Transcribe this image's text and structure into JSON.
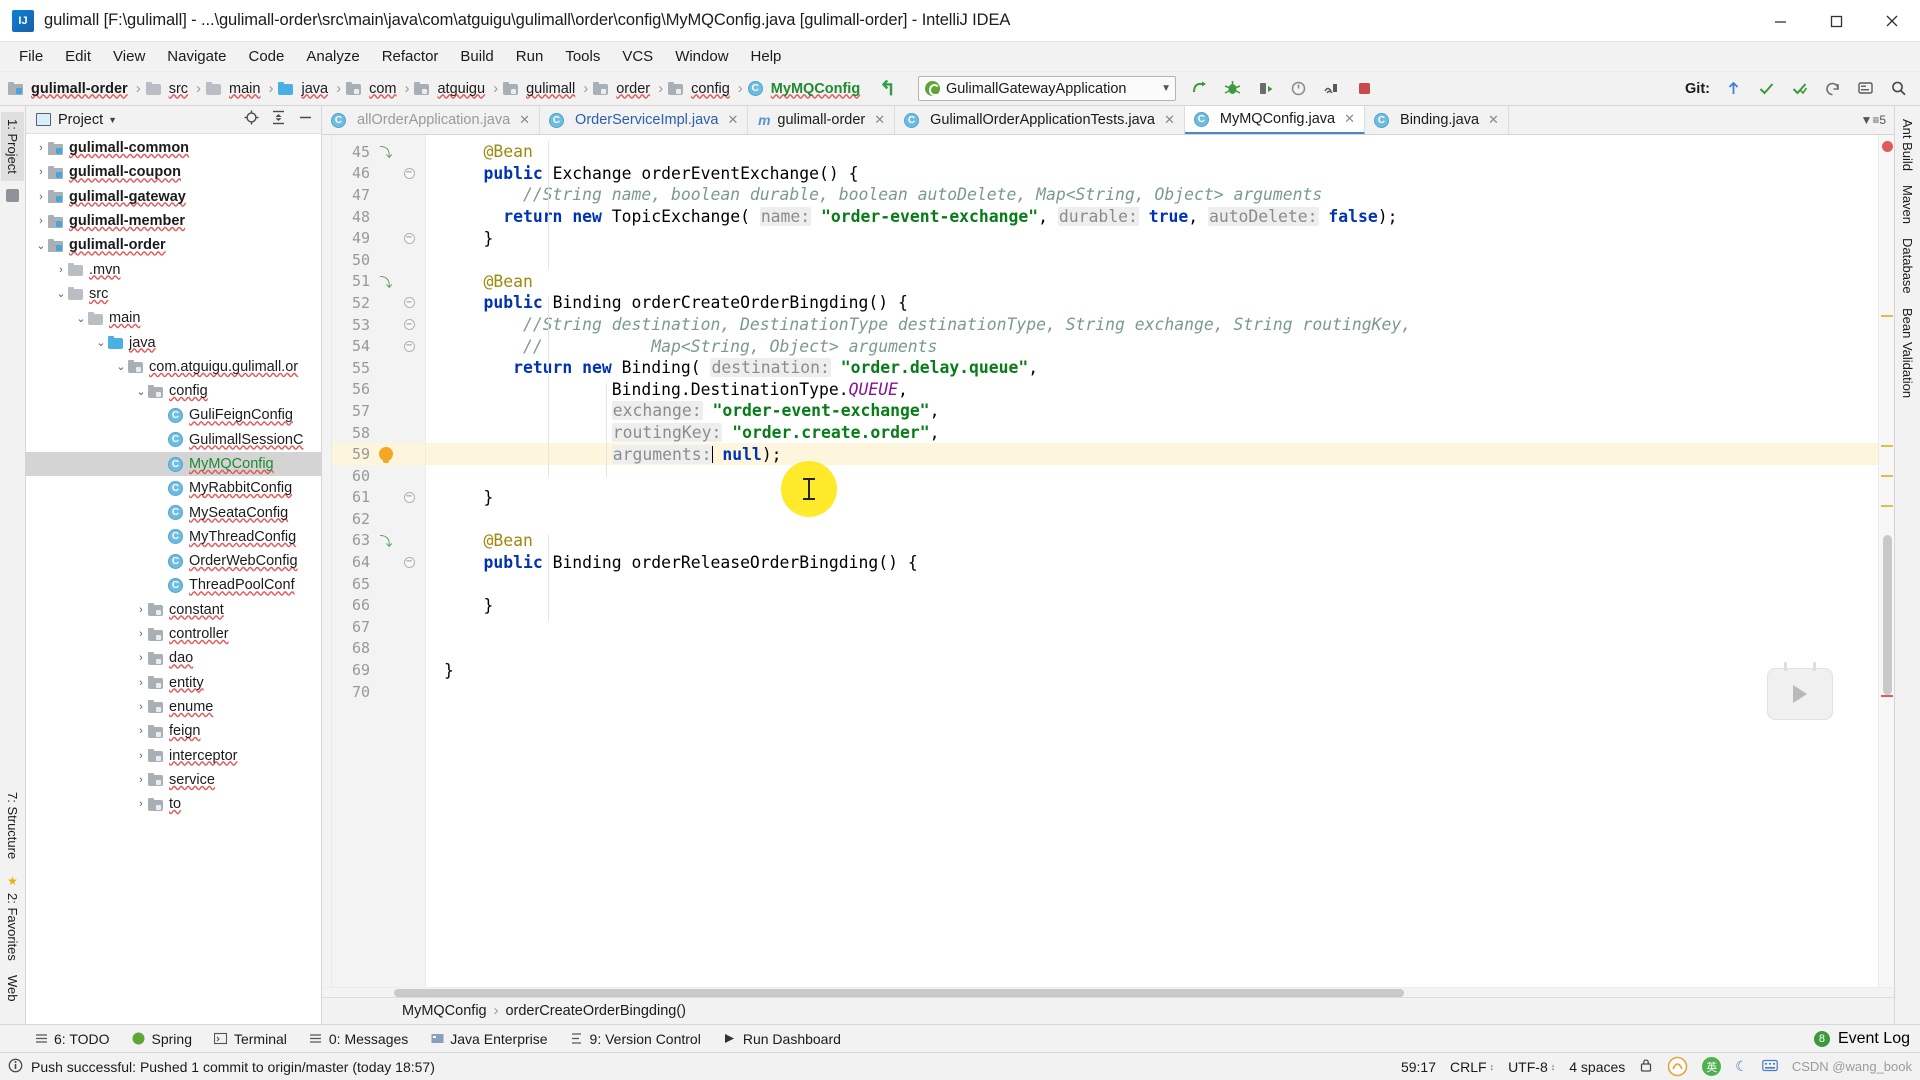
{
  "window": {
    "title": "gulimall [F:\\gulimall] - ...\\gulimall-order\\src\\main\\java\\com\\atguigu\\gulimall\\order\\config\\MyMQConfig.java [gulimall-order] - IntelliJ IDEA",
    "minimize_label": "—",
    "maximize_label": "□",
    "close_label": "✕"
  },
  "menubar": {
    "items": [
      "File",
      "Edit",
      "View",
      "Navigate",
      "Code",
      "Analyze",
      "Refactor",
      "Build",
      "Run",
      "Tools",
      "VCS",
      "Window",
      "Help"
    ]
  },
  "navbar": {
    "breadcrumbs": [
      {
        "label": "gulimall-order",
        "icon": "module-icon",
        "bold": true
      },
      {
        "label": "src",
        "icon": "folder-icon"
      },
      {
        "label": "main",
        "icon": "folder-icon"
      },
      {
        "label": "java",
        "icon": "source-folder-icon"
      },
      {
        "label": "com",
        "icon": "package-icon"
      },
      {
        "label": "atguigu",
        "icon": "package-icon"
      },
      {
        "label": "gulimall",
        "icon": "package-icon"
      },
      {
        "label": "order",
        "icon": "package-icon"
      },
      {
        "label": "config",
        "icon": "package-icon"
      },
      {
        "label": "MyMQConfig",
        "icon": "class-icon",
        "green": true
      }
    ],
    "run_config": "GulimallGatewayApplication",
    "git_label": "Git:",
    "toolbar_icons": [
      "run-icon",
      "debug-icon",
      "run-with-coverage-icon",
      "profiler-icon",
      "services-icon",
      "stop-icon"
    ],
    "git_icons": [
      "update-project-icon",
      "commit-icon",
      "push-icon",
      "rollback-icon",
      "ide-settings-icon",
      "search-everywhere-icon"
    ]
  },
  "project_panel": {
    "title": "Project",
    "tree": [
      {
        "label": "gulimall-common",
        "indent": 0,
        "arrow": "›",
        "icon": "module-icon",
        "bold": true
      },
      {
        "label": "gulimall-coupon",
        "indent": 0,
        "arrow": "›",
        "icon": "module-icon",
        "bold": true
      },
      {
        "label": "gulimall-gateway",
        "indent": 0,
        "arrow": "›",
        "icon": "module-icon",
        "bold": true
      },
      {
        "label": "gulimall-member",
        "indent": 0,
        "arrow": "›",
        "icon": "module-icon",
        "bold": true
      },
      {
        "label": "gulimall-order",
        "indent": 0,
        "arrow": "⌄",
        "icon": "module-icon",
        "bold": true
      },
      {
        "label": ".mvn",
        "indent": 1,
        "arrow": "›",
        "icon": "folder-icon"
      },
      {
        "label": "src",
        "indent": 1,
        "arrow": "⌄",
        "icon": "folder-icon"
      },
      {
        "label": "main",
        "indent": 2,
        "arrow": "⌄",
        "icon": "folder-icon"
      },
      {
        "label": "java",
        "indent": 3,
        "arrow": "⌄",
        "icon": "source-folder-icon"
      },
      {
        "label": "com.atguigu.gulimall.or",
        "indent": 4,
        "arrow": "⌄",
        "icon": "package-icon"
      },
      {
        "label": "config",
        "indent": 5,
        "arrow": "⌄",
        "icon": "package-icon"
      },
      {
        "label": "GuliFeignConfig",
        "indent": 6,
        "arrow": "",
        "icon": "class-icon"
      },
      {
        "label": "GulimallSessionC",
        "indent": 6,
        "arrow": "",
        "icon": "class-icon"
      },
      {
        "label": "MyMQConfig",
        "indent": 6,
        "arrow": "",
        "icon": "class-icon",
        "selected": true,
        "green": true
      },
      {
        "label": "MyRabbitConfig",
        "indent": 6,
        "arrow": "",
        "icon": "class-icon"
      },
      {
        "label": "MySeataConfig",
        "indent": 6,
        "arrow": "",
        "icon": "class-icon"
      },
      {
        "label": "MyThreadConfig",
        "indent": 6,
        "arrow": "",
        "icon": "class-icon"
      },
      {
        "label": "OrderWebConfig",
        "indent": 6,
        "arrow": "",
        "icon": "class-icon"
      },
      {
        "label": "ThreadPoolConf",
        "indent": 6,
        "arrow": "",
        "icon": "class-icon"
      },
      {
        "label": "constant",
        "indent": 5,
        "arrow": "›",
        "icon": "package-icon"
      },
      {
        "label": "controller",
        "indent": 5,
        "arrow": "›",
        "icon": "package-icon"
      },
      {
        "label": "dao",
        "indent": 5,
        "arrow": "›",
        "icon": "package-icon"
      },
      {
        "label": "entity",
        "indent": 5,
        "arrow": "›",
        "icon": "package-icon"
      },
      {
        "label": "enume",
        "indent": 5,
        "arrow": "›",
        "icon": "package-icon"
      },
      {
        "label": "feign",
        "indent": 5,
        "arrow": "›",
        "icon": "package-icon"
      },
      {
        "label": "interceptor",
        "indent": 5,
        "arrow": "›",
        "icon": "package-icon"
      },
      {
        "label": "service",
        "indent": 5,
        "arrow": "›",
        "icon": "package-icon"
      },
      {
        "label": "to",
        "indent": 5,
        "arrow": "›",
        "icon": "package-icon"
      }
    ]
  },
  "left_rail": {
    "tabs": [
      "1: Project",
      "7: Structure",
      "2: Favorites",
      "Web"
    ]
  },
  "right_rail": {
    "tabs": [
      "Ant Build",
      "Maven",
      "Database",
      "Bean Validation"
    ]
  },
  "editor_tabs": [
    {
      "label": "allOrderApplication.java",
      "icon": "class-icon",
      "active": false,
      "dim": true,
      "closable": true
    },
    {
      "label": "OrderServiceImpl.java",
      "icon": "class-icon",
      "active": false,
      "blue": true,
      "closable": true
    },
    {
      "label": "gulimall-order",
      "icon": "maven-icon",
      "active": false,
      "closable": true
    },
    {
      "label": "GulimallOrderApplicationTests.java",
      "icon": "class-icon",
      "active": false,
      "closable": true
    },
    {
      "label": "MyMQConfig.java",
      "icon": "class-icon",
      "active": true,
      "closable": true
    },
    {
      "label": "Binding.java",
      "icon": "class-icon",
      "active": false,
      "closable": true
    }
  ],
  "code": {
    "first_line": 45,
    "lines": [
      {
        "n": 45,
        "mark": "bean-gutter-icon",
        "fold": "",
        "segs": [
          {
            "t": "    ",
            "c": ""
          },
          {
            "t": "@Bean",
            "c": "ann"
          }
        ]
      },
      {
        "n": 46,
        "mark": "",
        "fold": "minus",
        "segs": [
          {
            "t": "    ",
            "c": ""
          },
          {
            "t": "public",
            "c": "kw"
          },
          {
            "t": " Exchange orderEventExchange() {",
            "c": ""
          }
        ]
      },
      {
        "n": 47,
        "mark": "",
        "fold": "",
        "segs": [
          {
            "t": "        ",
            "c": ""
          },
          {
            "t": "//String name, boolean durable, boolean autoDelete, Map<String, Object> arguments",
            "c": "cmt"
          }
        ]
      },
      {
        "n": 48,
        "mark": "",
        "fold": "",
        "segs": [
          {
            "t": "      ",
            "c": ""
          },
          {
            "t": "return",
            "c": "kw"
          },
          {
            "t": " ",
            "c": ""
          },
          {
            "t": "new",
            "c": "kw"
          },
          {
            "t": " TopicExchange( ",
            "c": ""
          },
          {
            "t": "name:",
            "c": "hint"
          },
          {
            "t": " ",
            "c": ""
          },
          {
            "t": "\"order-event-exchange\"",
            "c": "str"
          },
          {
            "t": ", ",
            "c": ""
          },
          {
            "t": "durable:",
            "c": "hint"
          },
          {
            "t": " ",
            "c": ""
          },
          {
            "t": "true",
            "c": "kw"
          },
          {
            "t": ", ",
            "c": ""
          },
          {
            "t": "autoDelete:",
            "c": "hint"
          },
          {
            "t": " ",
            "c": ""
          },
          {
            "t": "false",
            "c": "kw"
          },
          {
            "t": ");",
            "c": ""
          }
        ]
      },
      {
        "n": 49,
        "mark": "",
        "fold": "minus",
        "segs": [
          {
            "t": "    }",
            "c": ""
          }
        ]
      },
      {
        "n": 50,
        "mark": "",
        "fold": "",
        "segs": [
          {
            "t": "",
            "c": ""
          }
        ]
      },
      {
        "n": 51,
        "mark": "bean-gutter-icon",
        "fold": "",
        "segs": [
          {
            "t": "    ",
            "c": ""
          },
          {
            "t": "@Bean",
            "c": "ann"
          }
        ]
      },
      {
        "n": 52,
        "mark": "",
        "fold": "minus",
        "segs": [
          {
            "t": "    ",
            "c": ""
          },
          {
            "t": "public",
            "c": "kw"
          },
          {
            "t": " Binding orderCreateOrderBingding() {",
            "c": ""
          }
        ]
      },
      {
        "n": 53,
        "mark": "",
        "fold": "minus",
        "segs": [
          {
            "t": "        ",
            "c": ""
          },
          {
            "t": "//String destination, DestinationType destinationType, String exchange, String routingKey,",
            "c": "cmt"
          }
        ]
      },
      {
        "n": 54,
        "mark": "",
        "fold": "minus",
        "segs": [
          {
            "t": "        ",
            "c": ""
          },
          {
            "t": "//           Map<String, Object> arguments",
            "c": "cmt"
          }
        ]
      },
      {
        "n": 55,
        "mark": "",
        "fold": "",
        "segs": [
          {
            "t": "       ",
            "c": ""
          },
          {
            "t": "return",
            "c": "kw"
          },
          {
            "t": " ",
            "c": ""
          },
          {
            "t": "new",
            "c": "kw"
          },
          {
            "t": " Binding( ",
            "c": ""
          },
          {
            "t": "destination:",
            "c": "hint"
          },
          {
            "t": " ",
            "c": ""
          },
          {
            "t": "\"order.delay.queue\"",
            "c": "str"
          },
          {
            "t": ",",
            "c": ""
          }
        ]
      },
      {
        "n": 56,
        "mark": "",
        "fold": "",
        "segs": [
          {
            "t": "                 Binding.DestinationType.",
            "c": ""
          },
          {
            "t": "QUEUE",
            "c": "stat"
          },
          {
            "t": ",",
            "c": ""
          }
        ]
      },
      {
        "n": 57,
        "mark": "",
        "fold": "",
        "segs": [
          {
            "t": "                 ",
            "c": ""
          },
          {
            "t": "exchange:",
            "c": "hint"
          },
          {
            "t": " ",
            "c": ""
          },
          {
            "t": "\"order-event-exchange\"",
            "c": "str"
          },
          {
            "t": ",",
            "c": ""
          }
        ]
      },
      {
        "n": 58,
        "mark": "",
        "fold": "",
        "segs": [
          {
            "t": "                 ",
            "c": ""
          },
          {
            "t": "routingKey:",
            "c": "hint"
          },
          {
            "t": " ",
            "c": ""
          },
          {
            "t": "\"order.create.order\"",
            "c": "str"
          },
          {
            "t": ",",
            "c": ""
          }
        ]
      },
      {
        "n": 59,
        "mark": "intention-bulb-icon",
        "fold": "",
        "highlight": true,
        "caretAfter": 17,
        "segs": [
          {
            "t": "                 ",
            "c": ""
          },
          {
            "t": "arguments:",
            "c": "hint"
          },
          {
            "t": " ",
            "c": ""
          },
          {
            "t": "null",
            "c": "kw"
          },
          {
            "t": ");",
            "c": ""
          }
        ]
      },
      {
        "n": 60,
        "mark": "",
        "fold": "",
        "segs": [
          {
            "t": "",
            "c": ""
          }
        ]
      },
      {
        "n": 61,
        "mark": "",
        "fold": "minus",
        "segs": [
          {
            "t": "    }",
            "c": ""
          }
        ]
      },
      {
        "n": 62,
        "mark": "",
        "fold": "",
        "segs": [
          {
            "t": "",
            "c": ""
          }
        ]
      },
      {
        "n": 63,
        "mark": "bean-gutter-icon",
        "fold": "",
        "segs": [
          {
            "t": "    ",
            "c": ""
          },
          {
            "t": "@Bean",
            "c": "ann"
          }
        ]
      },
      {
        "n": 64,
        "mark": "",
        "fold": "minus",
        "segs": [
          {
            "t": "    ",
            "c": ""
          },
          {
            "t": "public",
            "c": "kw"
          },
          {
            "t": " Binding orderReleaseOrderBingding() {",
            "c": ""
          }
        ]
      },
      {
        "n": 65,
        "mark": "",
        "fold": "",
        "segs": [
          {
            "t": "",
            "c": ""
          }
        ]
      },
      {
        "n": 66,
        "mark": "",
        "fold": "",
        "segs": [
          {
            "t": "    }",
            "c": ""
          }
        ]
      },
      {
        "n": 67,
        "mark": "",
        "fold": "",
        "segs": [
          {
            "t": "",
            "c": ""
          }
        ]
      },
      {
        "n": 68,
        "mark": "",
        "fold": "",
        "segs": [
          {
            "t": "",
            "c": ""
          }
        ]
      },
      {
        "n": 69,
        "mark": "",
        "fold": "",
        "segs": [
          {
            "t": "}",
            "c": ""
          }
        ]
      },
      {
        "n": 70,
        "mark": "",
        "fold": "",
        "segs": [
          {
            "t": "",
            "c": ""
          }
        ]
      }
    ]
  },
  "code_breadcrumbs": {
    "items": [
      "MyMQConfig",
      "orderCreateOrderBingding()"
    ],
    "separator": "›"
  },
  "bottom_toolwindows": [
    {
      "label": "6: TODO",
      "icon": "todo-icon"
    },
    {
      "label": "Spring",
      "icon": "spring-icon"
    },
    {
      "label": "Terminal",
      "icon": "terminal-icon"
    },
    {
      "label": "0: Messages",
      "icon": "messages-icon"
    },
    {
      "label": "Java Enterprise",
      "icon": "java-enterprise-icon"
    },
    {
      "label": "9: Version Control",
      "icon": "version-control-icon"
    },
    {
      "label": "Run Dashboard",
      "icon": "run-dashboard-icon"
    }
  ],
  "event_log": {
    "label": "Event Log",
    "badge": "8"
  },
  "statusbar": {
    "message": "Push successful: Pushed 1 commit to origin/master (today 18:57)",
    "caret_position": "59:17",
    "line_separator": "CRLF",
    "encoding": "UTF-8",
    "indent": "4 spaces",
    "ime_label": "英",
    "watermark": "CSDN @wang_book"
  },
  "colors": {
    "accent": "#4a88c7",
    "keyword": "#0033b3",
    "string": "#067d17",
    "comment": "#7a9b8a",
    "annotation": "#9e880d",
    "static_field": "#871094",
    "highlight_line": "#fdf6dd",
    "cursor_halo": "#ffe81a",
    "green_text": "#1f8a2f",
    "error": "#e05a5a"
  }
}
